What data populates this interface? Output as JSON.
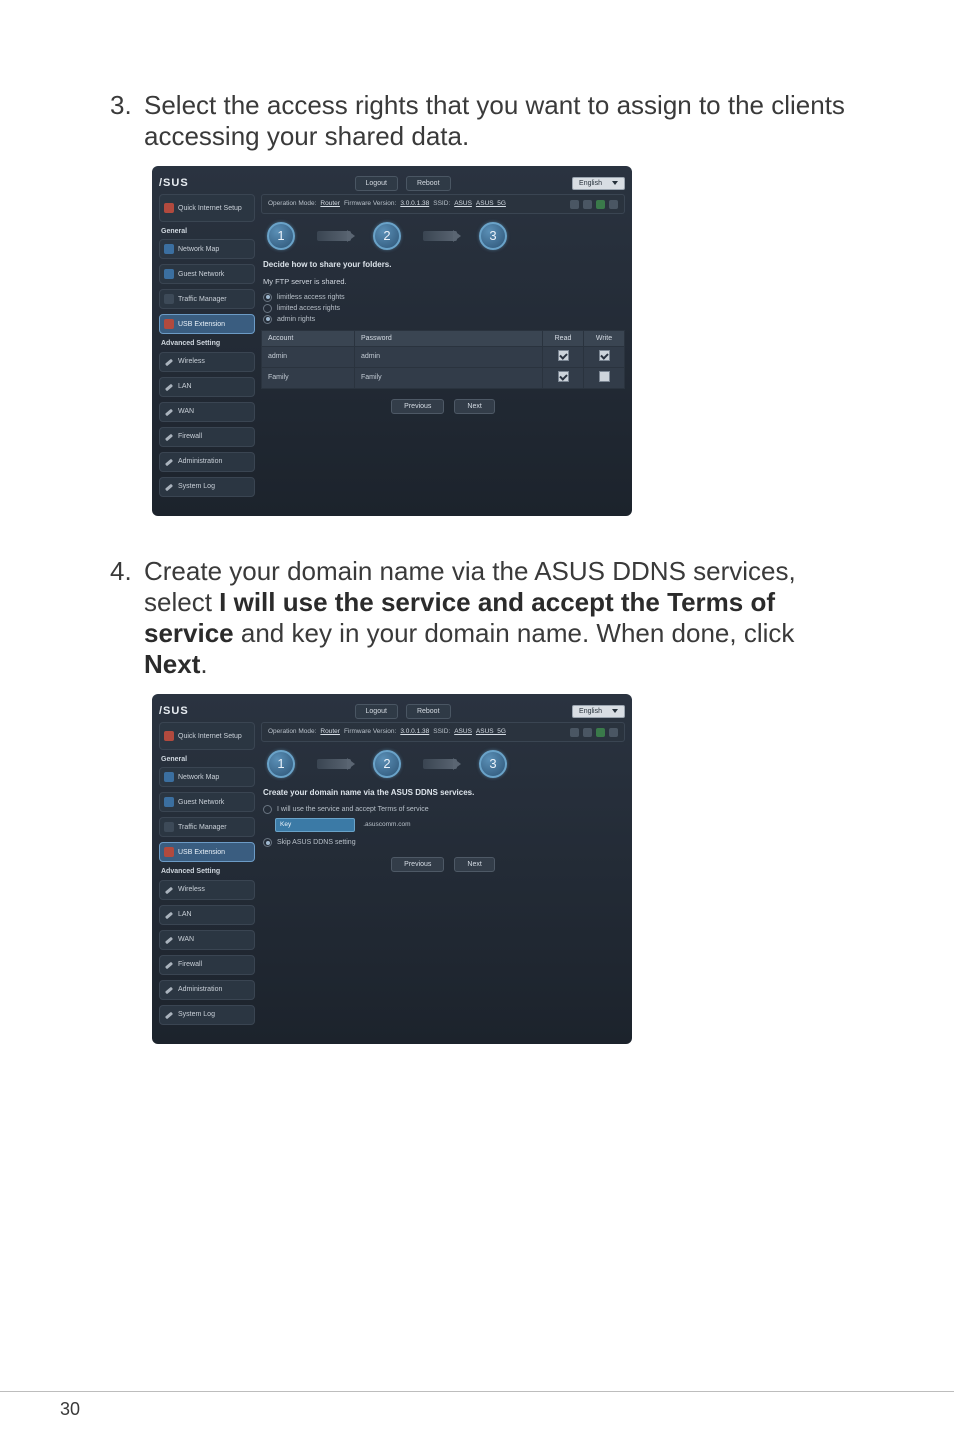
{
  "steps": {
    "s3": {
      "num": "3.",
      "text": "Select the access rights that you want to assign to the clients accessing your shared data."
    },
    "s4": {
      "num": "4.",
      "prefix": "Create your domain name via the ASUS DDNS services, select ",
      "bold1": "I will use the service and accept the Terms of service",
      "mid": " and key in your domain name. When done, click ",
      "bold2": "Next",
      "suffix": "."
    }
  },
  "router_common": {
    "logo": "/SUS",
    "btn_logout": "Logout",
    "btn_reboot": "Reboot",
    "lang": "English",
    "status_prefix": "Operation Mode: ",
    "status_mode": "Router",
    "fw_prefix": "Firmware Version: ",
    "fw_ver": "3.0.0.1.38",
    "ssid_prefix": "SSID: ",
    "ssid1": "ASUS",
    "ssid2": "ASUS_5G",
    "side_qis": "Quick Internet Setup",
    "side_general": "General",
    "side_netmap": "Network Map",
    "side_guest": "Guest Network",
    "side_traffic": "Traffic Manager",
    "side_usb": "USB Extension",
    "side_advanced": "Advanced Setting",
    "side_wireless": "Wireless",
    "side_lan": "LAN",
    "side_wan": "WAN",
    "side_firewall": "Firewall",
    "side_admin": "Administration",
    "side_syslog": "System Log",
    "btn_prev": "Previous",
    "btn_next": "Next",
    "wz1": "1",
    "wz2": "2",
    "wz3": "3"
  },
  "shot1": {
    "heading": "Decide how to share your folders.",
    "sub": "My FTP server is shared.",
    "opt1": "limitless access rights",
    "opt2": "limited access rights",
    "opt3": "admin rights",
    "th_account": "Account",
    "th_password": "Password",
    "th_read": "Read",
    "th_write": "Write",
    "row1_acc": "admin",
    "row1_pw": "admin",
    "row2_acc": "Family",
    "row2_pw": "Family"
  },
  "shot2": {
    "heading": "Create your domain name via the ASUS DDNS services.",
    "opt1": "I will use the service and accept Terms of service",
    "opt2": "Skip ASUS DDNS setting",
    "input_val": "Key",
    "suffix": ".asuscomm.com"
  },
  "page_number": "30"
}
